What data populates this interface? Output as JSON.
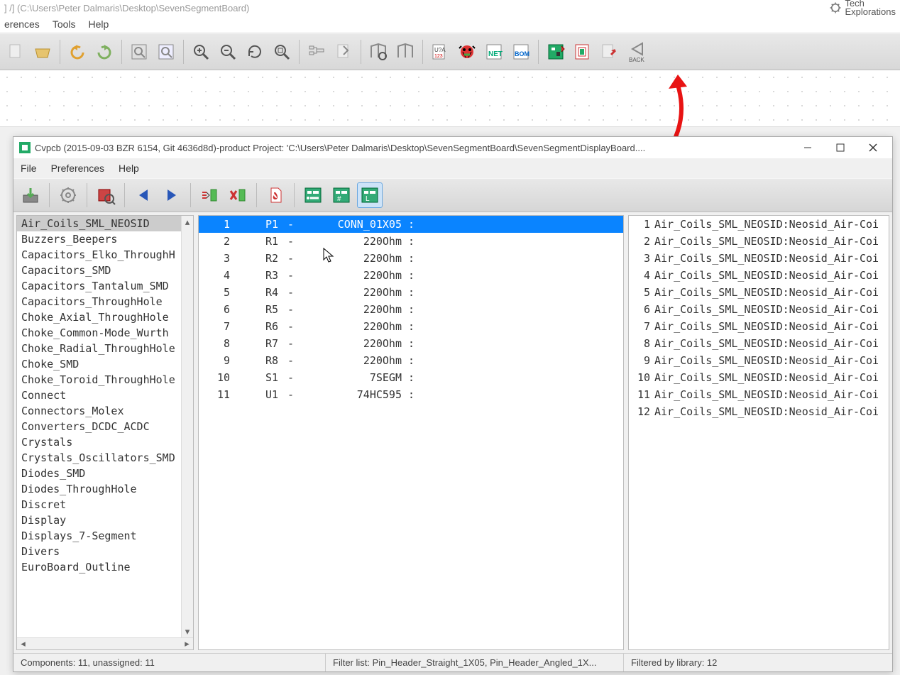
{
  "background_window": {
    "title": "] /] (C:\\Users\\Peter Dalmaris\\Desktop\\SevenSegmentBoard)",
    "menu": {
      "item1": "erences",
      "item2": "Tools",
      "item3": "Help"
    },
    "logo_line1": "Tech",
    "logo_line2": "Explorations"
  },
  "dialog": {
    "title": "Cvpcb (2015-09-03 BZR 6154, Git 4636d8d)-product  Project: 'C:\\Users\\Peter Dalmaris\\Desktop\\SevenSegmentBoard\\SevenSegmentDisplayBoard....",
    "menu": {
      "file": "File",
      "preferences": "Preferences",
      "help": "Help"
    }
  },
  "libs": [
    "Air_Coils_SML_NEOSID",
    "Buzzers_Beepers",
    "Capacitors_Elko_ThroughH",
    "Capacitors_SMD",
    "Capacitors_Tantalum_SMD",
    "Capacitors_ThroughHole",
    "Choke_Axial_ThroughHole",
    "Choke_Common-Mode_Wurth",
    "Choke_Radial_ThroughHole",
    "Choke_SMD",
    "Choke_Toroid_ThroughHole",
    "Connect",
    "Connectors_Molex",
    "Converters_DCDC_ACDC",
    "Crystals",
    "Crystals_Oscillators_SMD",
    "Diodes_SMD",
    "Diodes_ThroughHole",
    "Discret",
    "Display",
    "Displays_7-Segment",
    "Divers",
    "EuroBoard_Outline"
  ],
  "components": [
    {
      "idx": "1",
      "ref": "P1",
      "val": "CONN_01X05"
    },
    {
      "idx": "2",
      "ref": "R1",
      "val": "220Ohm"
    },
    {
      "idx": "3",
      "ref": "R2",
      "val": "220Ohm"
    },
    {
      "idx": "4",
      "ref": "R3",
      "val": "220Ohm"
    },
    {
      "idx": "5",
      "ref": "R4",
      "val": "220Ohm"
    },
    {
      "idx": "6",
      "ref": "R5",
      "val": "220Ohm"
    },
    {
      "idx": "7",
      "ref": "R6",
      "val": "220Ohm"
    },
    {
      "idx": "8",
      "ref": "R7",
      "val": "220Ohm"
    },
    {
      "idx": "9",
      "ref": "R8",
      "val": "220Ohm"
    },
    {
      "idx": "10",
      "ref": "S1",
      "val": "7SEGM"
    },
    {
      "idx": "11",
      "ref": "U1",
      "val": "74HC595"
    }
  ],
  "footprints": [
    {
      "idx": "1",
      "txt": "Air_Coils_SML_NEOSID:Neosid_Air-Coi"
    },
    {
      "idx": "2",
      "txt": "Air_Coils_SML_NEOSID:Neosid_Air-Coi"
    },
    {
      "idx": "3",
      "txt": "Air_Coils_SML_NEOSID:Neosid_Air-Coi"
    },
    {
      "idx": "4",
      "txt": "Air_Coils_SML_NEOSID:Neosid_Air-Coi"
    },
    {
      "idx": "5",
      "txt": "Air_Coils_SML_NEOSID:Neosid_Air-Coi"
    },
    {
      "idx": "6",
      "txt": "Air_Coils_SML_NEOSID:Neosid_Air-Coi"
    },
    {
      "idx": "7",
      "txt": "Air_Coils_SML_NEOSID:Neosid_Air-Coi"
    },
    {
      "idx": "8",
      "txt": "Air_Coils_SML_NEOSID:Neosid_Air-Coi"
    },
    {
      "idx": "9",
      "txt": "Air_Coils_SML_NEOSID:Neosid_Air-Coi"
    },
    {
      "idx": "10",
      "txt": "Air_Coils_SML_NEOSID:Neosid_Air-Coi"
    },
    {
      "idx": "11",
      "txt": "Air_Coils_SML_NEOSID:Neosid_Air-Coi"
    },
    {
      "idx": "12",
      "txt": "Air_Coils_SML_NEOSID:Neosid_Air-Coi"
    }
  ],
  "status": {
    "left": "Components: 11, unassigned: 11",
    "mid": "Filter list: Pin_Header_Straight_1X05, Pin_Header_Angled_1X...",
    "right": "Filtered by library: 12"
  }
}
